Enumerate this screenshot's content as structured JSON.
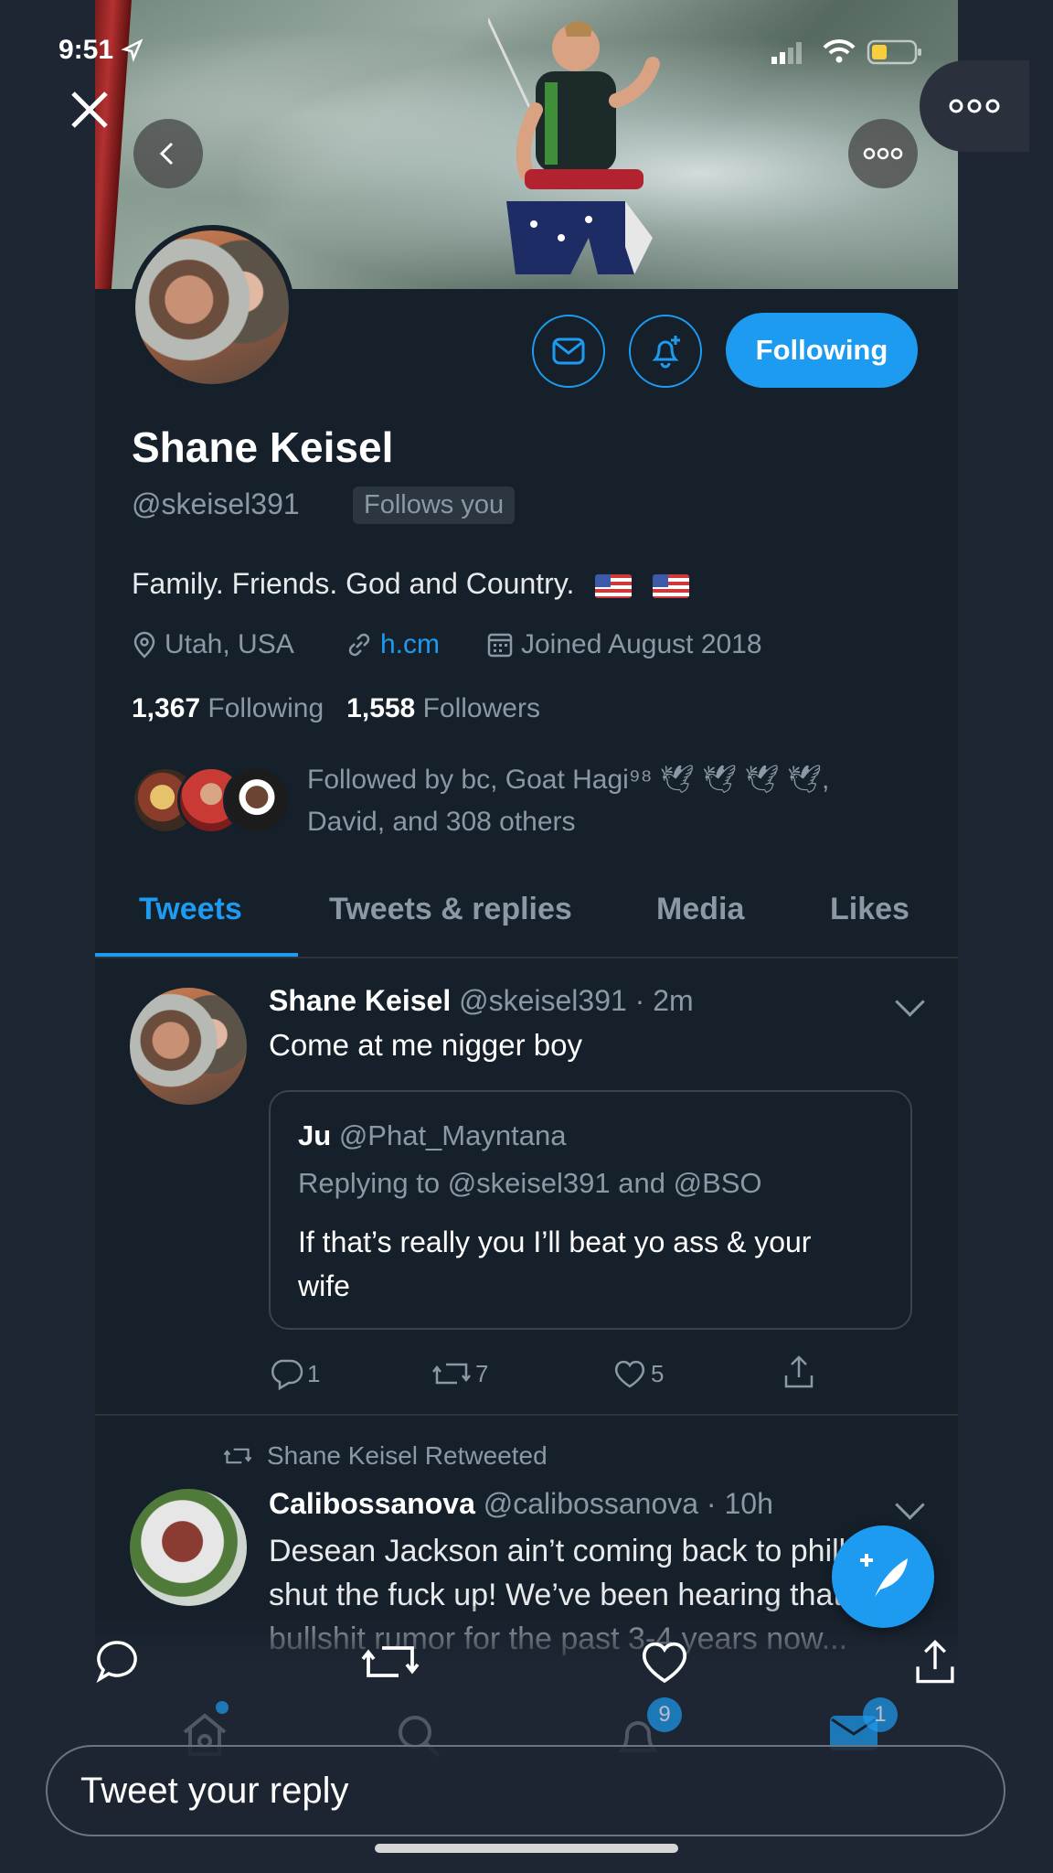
{
  "status": {
    "time": "9:51"
  },
  "profile": {
    "name": "Shane Keisel",
    "handle": "@skeisel391",
    "follows_you": "Follows you",
    "follow_button": "Following",
    "bio": "Family. Friends. God and Country.",
    "location": "Utah, USA",
    "link": "h.cm",
    "joined": "Joined August 2018",
    "following_count": "1,367",
    "following_label": "Following",
    "followers_count": "1,558",
    "followers_label": "Followers",
    "followed_by_line1": "Followed by bc, Goat Hagi⁹⁸ 🕊 🕊 🕊 🕊,",
    "followed_by_line2": "David, and 308 others"
  },
  "tabs": [
    "Tweets",
    "Tweets & replies",
    "Media",
    "Likes"
  ],
  "tweets": [
    {
      "name": "Shane Keisel",
      "handle_time": "@skeisel391 · 2m",
      "text": "Come at me nigger boy",
      "quote": {
        "name": "Ju",
        "handle": "@Phat_Mayntana",
        "replying": "Replying to @skeisel391 and @BSO",
        "text": "If that’s really you I’ll beat yo ass & your wife"
      },
      "replies": "1",
      "retweets": "7",
      "likes": "5"
    },
    {
      "retweeted_by": "Shane Keisel Retweeted",
      "name": "Calibossanova",
      "handle_time": "@calibossanova · 10h",
      "text": "Desean Jackson ain’t coming back to philly so shut the fuck up! We’ve been hearing that bullshit rumor for the past 3-4 years now..."
    }
  ],
  "tabbar": {
    "notifications_badge": "9",
    "messages_badge": "1"
  },
  "reply_placeholder": "Tweet your reply",
  "colors": {
    "accent": "#1d9bf0",
    "background": "#15202b",
    "muted": "#8b98a5"
  }
}
